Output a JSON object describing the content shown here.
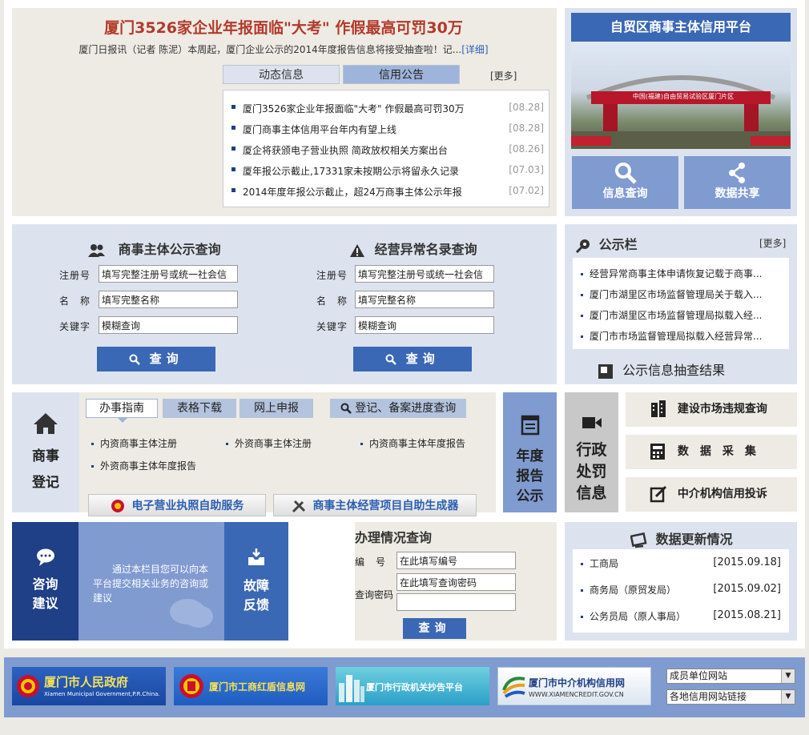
{
  "headline": {
    "title": "厦门3526家企业年报面临\"大考\" 作假最高可罚30万",
    "summary": "厦门日报讯（记者 陈泥）本周起，厦门企业公示的2014年度报告信息将接受抽查啦！记...",
    "detail_link": "[详细]"
  },
  "news_tabs": {
    "tab1": "动态信息",
    "tab2": "信用公告",
    "more": "[更多]"
  },
  "news": [
    {
      "title": "厦门3526家企业年报面临\"大考\" 作假最高可罚30万",
      "date": "[08.28]"
    },
    {
      "title": "厦门商事主体信用平台年内有望上线",
      "date": "[08.28]"
    },
    {
      "title": "厦企将获颁电子营业执照 简政放权相关方案出台",
      "date": "[08.26]"
    },
    {
      "title": "厦年报公示截止,17331家未按期公示将留永久记录",
      "date": "[07.03]"
    },
    {
      "title": "2014年度年报公示截止，超24万商事主体公示年报",
      "date": "[07.02]"
    }
  ],
  "platform": {
    "title": "自贸区商事主体信用平台",
    "banner_text": "中国(福建)自由贸易试验区厦门片区",
    "info_query": "信息查询",
    "data_share": "数据共享"
  },
  "public_query": {
    "heading": "商事主体公示查询",
    "reg_label": "注册号",
    "reg_value": "填写完整注册号或统一社会信",
    "name_label": "名　称",
    "name_value": "填写完整名称",
    "kw_label": "关键字",
    "kw_value": "模糊查询",
    "button": "查询"
  },
  "abnormal_query": {
    "heading": "经营异常名录查询",
    "reg_label": "注册号",
    "reg_value": "填写完整注册号或统一社会信",
    "name_label": "名　称",
    "name_value": "填写完整名称",
    "kw_label": "关键字",
    "kw_value": "模糊查询",
    "button": "查询"
  },
  "notice": {
    "heading": "公示栏",
    "more": "[更多]",
    "items": [
      "经营异常商事主体申请恢复记载于商事...",
      "厦门市湖里区市场监督管理局关于载入...",
      "厦门市湖里区市场监督管理局拟载入经...",
      "厦门市市场监督管理局拟载入经营异常..."
    ],
    "sample_result": "公示信息抽查结果"
  },
  "registration": {
    "side_label_1": "商事",
    "side_label_2": "登记",
    "tabs": [
      "办事指南",
      "表格下载",
      "网上申报"
    ],
    "progress": "登记、备案进度查询",
    "links": [
      "内资商事主体注册",
      "外资商事主体注册",
      "内资商事主体年度报告",
      "外资商事主体年度报告"
    ],
    "btn_license": "电子营业执照自助服务",
    "btn_generator": "商事主体经营项目自助生成器"
  },
  "annual": {
    "l1": "年度",
    "l2": "报告",
    "l3": "公示"
  },
  "penalty": {
    "l1": "行政",
    "l2": "处罚",
    "l3": "信息"
  },
  "right_tiles": {
    "t1": "建设市场违规查询",
    "t2": "数　据　采　集",
    "t3": "中介机构信用投诉"
  },
  "consult": {
    "l1": "咨询",
    "l2": "建议",
    "text": "通过本栏目您可以向本平台提交相关业务的咨询或建议",
    "r1": "故障",
    "r2": "反馈"
  },
  "processing": {
    "heading": "办理情况查询",
    "no_label": "编　号",
    "no_value": "在此填写编号",
    "pw_label": "查询密码",
    "pw_value": "在此填写查询密码",
    "button": "查询"
  },
  "updates": {
    "heading": "数据更新情况",
    "rows": [
      {
        "name": "工商局",
        "date": "[2015.09.18]"
      },
      {
        "name": "商务局（原贸发局）",
        "date": "[2015.09.02]"
      },
      {
        "name": "公务员局（原人事局）",
        "date": "[2015.08.21]"
      }
    ]
  },
  "footer": {
    "b1": "厦门市人民政府",
    "b1_sub": "Xiamen Municipal Government,P.R.China.",
    "b2": "厦门市工商红盾信息网",
    "b3": "厦门市行政机关抄告平台",
    "b4": "厦门市中介机构信用网",
    "b4_sub": "WWW.XIAMENCREDIT.GOV.CN",
    "sel1": "成员单位网站",
    "sel2": "各地信用网站链接"
  },
  "colors": {
    "blue_dark": "#1f3f86",
    "blue": "#3b68b4",
    "blue_light": "#7f9bd0",
    "red": "#b23a2b",
    "beige": "#eeebe4",
    "gray": "#c8c8c8"
  }
}
